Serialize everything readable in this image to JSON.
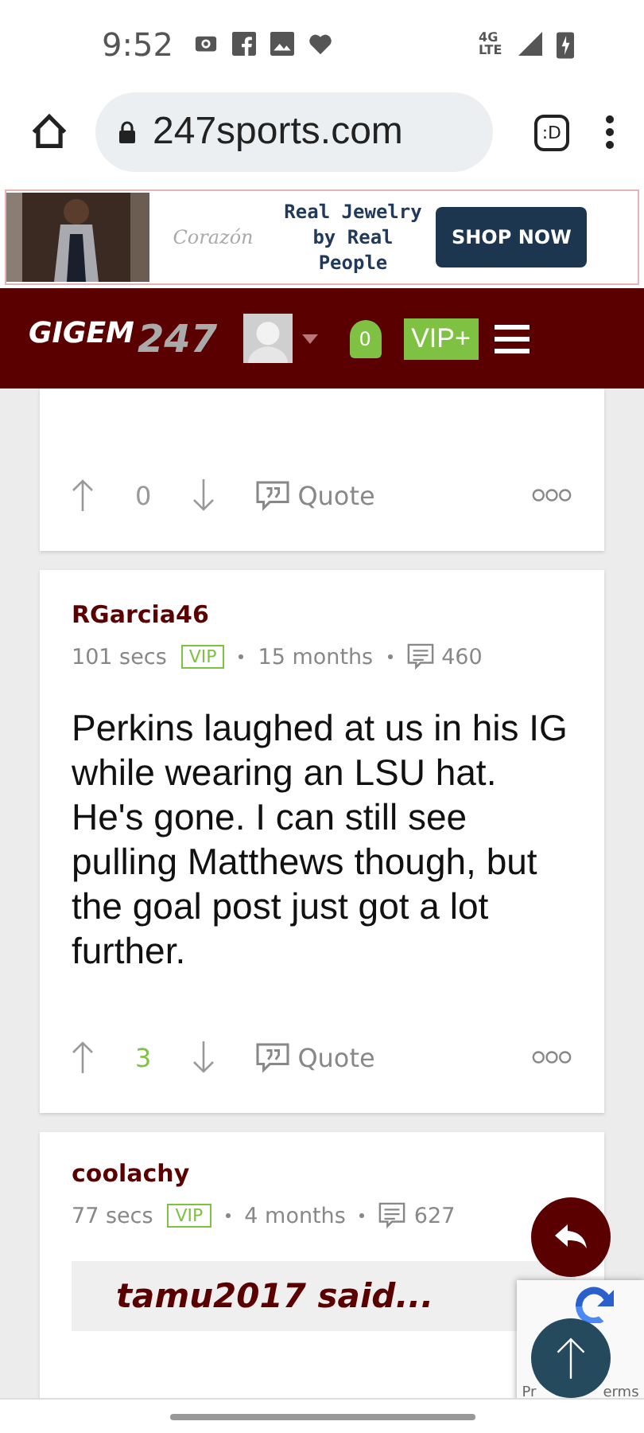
{
  "status_bar": {
    "time": "9:52",
    "network": "4G LTE"
  },
  "browser": {
    "url": "247sports.com",
    "tab_label": ":D"
  },
  "ad": {
    "brand": "Corazón",
    "headline": "Real Jewelry by Real People",
    "button": "SHOP NOW"
  },
  "site_header": {
    "logo": "GIGEM",
    "logo_number": "247",
    "notifications": "0",
    "vip": "VIP+"
  },
  "posts": [
    {
      "kind": "partial",
      "votes": "0",
      "votes_positive": false,
      "quote_label": "Quote"
    },
    {
      "kind": "full",
      "username": "RGarcia46",
      "time": "101 secs",
      "badge": "VIP",
      "tenure": "15 months",
      "posts": "460",
      "body": "Perkins laughed at us in his IG while wearing an LSU hat. He's gone. I can still see pulling Matthews though, but the goal post just got a lot further.",
      "votes": "3",
      "votes_positive": true,
      "quote_label": "Quote"
    },
    {
      "kind": "quoting",
      "username": "coolachy",
      "time": "77 secs",
      "badge": "VIP",
      "tenure": "4 months",
      "posts": "627",
      "quote_author": "tamu2017 said..."
    }
  ],
  "recaptcha": {
    "left": "Pr",
    "right": "erms"
  }
}
